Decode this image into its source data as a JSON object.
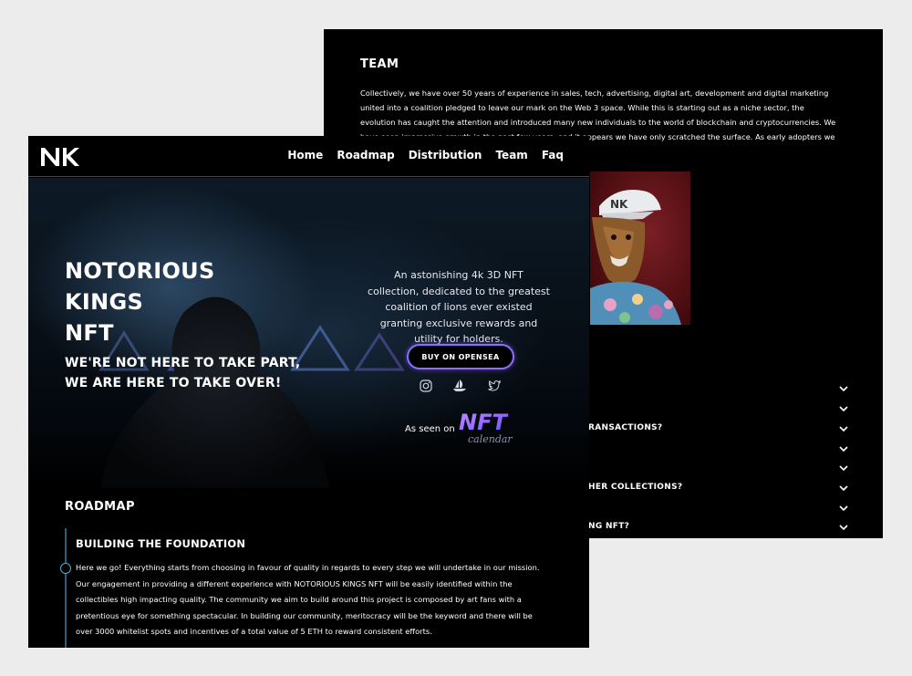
{
  "team": {
    "title": "TEAM",
    "text": "Collectively, we have over 50 years of experience in sales, tech, advertising, digital art, development and digital marketing united into a coalition pledged to leave our mark on the Web 3 space. While this is starting out as a niche sector, the evolution has caught the attention and introduced many new individuals to the world of blockchain and cryptocurrencies. We have seen impressive growth in the past few years, and it appears we have only scratched the surface. As early adopters we have the opportunity to ... gital art."
  },
  "faq": {
    "items": [
      {
        "label": ""
      },
      {
        "label": ""
      },
      {
        "label": "RANSACTIONS?"
      },
      {
        "label": ""
      },
      {
        "label": ""
      },
      {
        "label": "HER COLLECTIONS?"
      },
      {
        "label": ""
      },
      {
        "label": "NG NFT?"
      }
    ]
  },
  "nav": {
    "logo_text": "NK",
    "links": [
      "Home",
      "Roadmap",
      "Distribution",
      "Team",
      "Faq"
    ]
  },
  "hero": {
    "title_lines": [
      "NOTORIOUS",
      "KINGS",
      "NFT"
    ],
    "tagline_lines": [
      "WE'RE NOT HERE TO TAKE PART,",
      "WE ARE HERE TO TAKE OVER!"
    ],
    "description": "An astonishing 4k 3D NFT collection, dedicated to the greatest coalition of lions ever existed granting exclusive rewards and utility for holders.",
    "cta_label": "BUY ON OPENSEA",
    "social_icons": [
      "instagram-icon",
      "opensea-icon",
      "twitter-icon"
    ],
    "seen_label": "As seen on",
    "seen_logo_main": "NFT",
    "seen_logo_sub": "calendar"
  },
  "roadmap": {
    "title": "ROADMAP",
    "phase_title": "BUILDING THE FOUNDATION",
    "phase_text": "Here we go! Everything starts from choosing in favour of quality in regards to every step we will undertake in our mission. Our engagement in providing a different experience with NOTORIOUS KINGS NFT will be easily identified within the collectibles high impacting quality. The community we aim to build around this project is composed by art fans with a pretentious eye for something spectacular. In building our community, meritocracy will be the keyword and there will be over 3000 whitelist spots and incentives of a total value of 5 ETH to reward consistent efforts."
  },
  "colors": {
    "page_bg": "#ececec",
    "panel_bg": "#000000",
    "accent": "#8d6cff",
    "timeline": "#55a7cf"
  }
}
